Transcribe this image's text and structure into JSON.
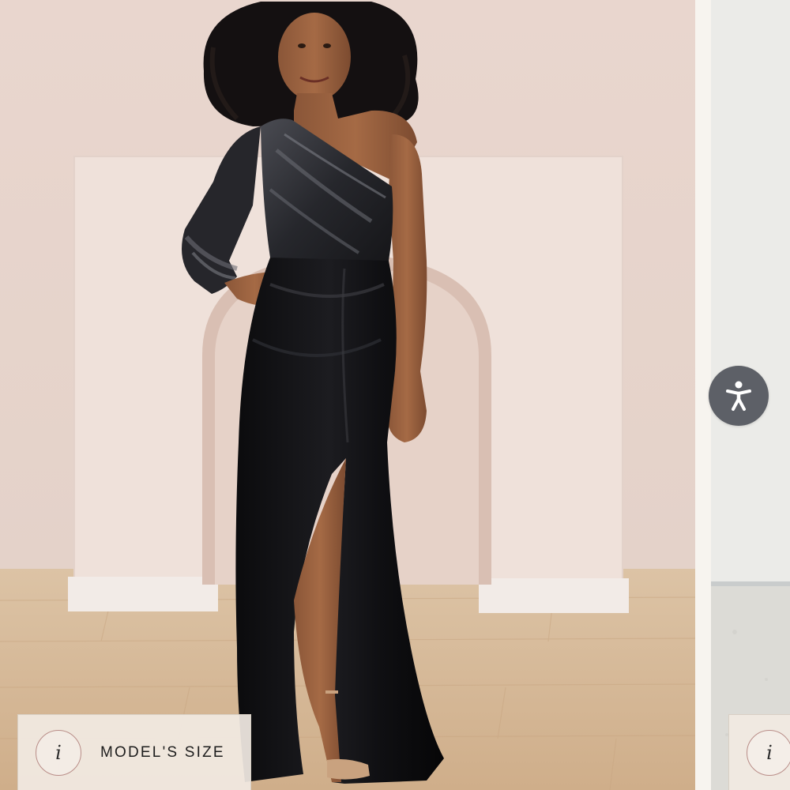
{
  "gallery": {
    "current_slide": {
      "info_chip": {
        "icon": "info-icon",
        "glyph": "i",
        "label": "MODEL'S SIZE"
      }
    },
    "next_slide": {
      "info_chip": {
        "icon": "info-icon",
        "glyph": "i"
      }
    }
  },
  "accessibility_widget": {
    "icon": "accessibility-person-icon",
    "color": "#5d6067"
  },
  "colors": {
    "backdrop": "#e8d6cf",
    "floor": "#d6b896",
    "dress": "#0d0d0f",
    "chip_background": "#f1eae2",
    "chip_border": "#b98d88"
  }
}
